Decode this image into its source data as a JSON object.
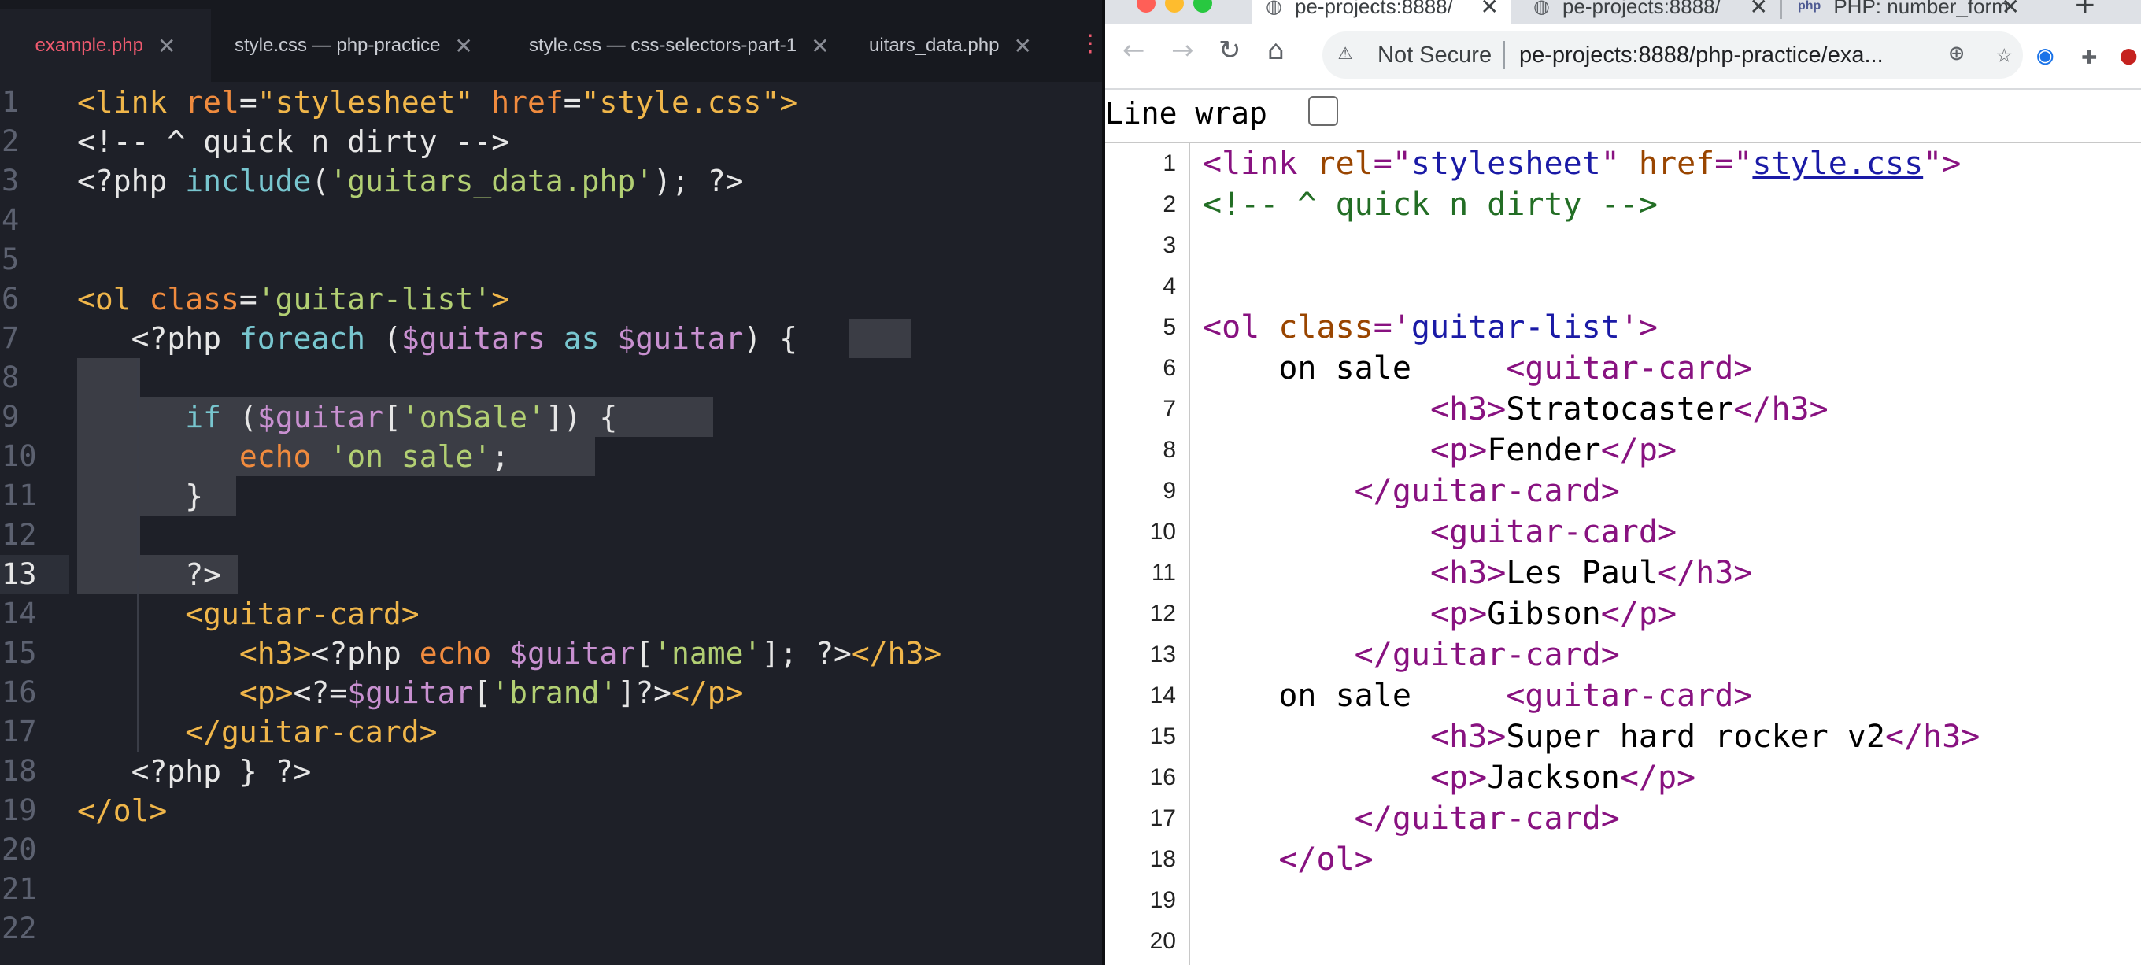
{
  "editor": {
    "tabs": [
      {
        "label": "example.php",
        "active": true
      },
      {
        "label": "style.css — php-practice",
        "active": false
      },
      {
        "label": "style.css — css-selectors-part-1",
        "active": false
      },
      {
        "label": "uitars_data.php",
        "active": false
      }
    ],
    "current_line": 13,
    "lines": [
      {
        "n": "1",
        "tokens": [
          {
            "t": "<link ",
            "c": "y"
          },
          {
            "t": "rel",
            "c": "o"
          },
          {
            "t": "=",
            "c": "t"
          },
          {
            "t": "\"stylesheet\"",
            "c": "y"
          },
          {
            "t": " ",
            "c": "t"
          },
          {
            "t": "href",
            "c": "o"
          },
          {
            "t": "=",
            "c": "t"
          },
          {
            "t": "\"style.css\"",
            "c": "y"
          },
          {
            "t": ">",
            "c": "y"
          }
        ]
      },
      {
        "n": "2",
        "tokens": [
          {
            "t": "<!-- ^ quick n dirty -->",
            "c": "t"
          }
        ]
      },
      {
        "n": "3",
        "tokens": [
          {
            "t": "<?php ",
            "c": "t"
          },
          {
            "t": "include",
            "c": "c"
          },
          {
            "t": "(",
            "c": "t"
          },
          {
            "t": "'guitars_data.php'",
            "c": "g"
          },
          {
            "t": "); ?>",
            "c": "t"
          }
        ]
      },
      {
        "n": "4",
        "tokens": []
      },
      {
        "n": "5",
        "tokens": []
      },
      {
        "n": "6",
        "tokens": [
          {
            "t": "<ol ",
            "c": "y"
          },
          {
            "t": "class",
            "c": "o"
          },
          {
            "t": "=",
            "c": "t"
          },
          {
            "t": "'guitar-list'",
            "c": "g"
          },
          {
            "t": ">",
            "c": "y"
          }
        ]
      },
      {
        "n": "7",
        "tokens": [
          {
            "t": "   <?php ",
            "c": "t"
          },
          {
            "t": "foreach",
            "c": "c"
          },
          {
            "t": " (",
            "c": "t"
          },
          {
            "t": "$guitars",
            "c": "p"
          },
          {
            "t": " as ",
            "c": "c"
          },
          {
            "t": "$guitar",
            "c": "p"
          },
          {
            "t": ") {",
            "c": "t"
          }
        ]
      },
      {
        "n": "8",
        "tokens": []
      },
      {
        "n": "9",
        "tokens": [
          {
            "t": "      ",
            "c": "t"
          },
          {
            "t": "if",
            "c": "c"
          },
          {
            "t": " (",
            "c": "t"
          },
          {
            "t": "$guitar",
            "c": "p"
          },
          {
            "t": "[",
            "c": "t"
          },
          {
            "t": "'onSale'",
            "c": "g"
          },
          {
            "t": "]) {",
            "c": "t"
          }
        ]
      },
      {
        "n": "10",
        "tokens": [
          {
            "t": "         ",
            "c": "t"
          },
          {
            "t": "echo",
            "c": "o"
          },
          {
            "t": " ",
            "c": "t"
          },
          {
            "t": "'on sale'",
            "c": "g"
          },
          {
            "t": ";",
            "c": "t"
          }
        ]
      },
      {
        "n": "11",
        "tokens": [
          {
            "t": "      }",
            "c": "t"
          }
        ]
      },
      {
        "n": "12",
        "tokens": []
      },
      {
        "n": "13",
        "tokens": [
          {
            "t": "      ?>",
            "c": "t"
          }
        ]
      },
      {
        "n": "14",
        "tokens": [
          {
            "t": "      <guitar-card>",
            "c": "y"
          }
        ]
      },
      {
        "n": "15",
        "tokens": [
          {
            "t": "         <h3>",
            "c": "y"
          },
          {
            "t": "<?php ",
            "c": "t"
          },
          {
            "t": "echo",
            "c": "o"
          },
          {
            "t": " ",
            "c": "t"
          },
          {
            "t": "$guitar",
            "c": "p"
          },
          {
            "t": "[",
            "c": "t"
          },
          {
            "t": "'name'",
            "c": "g"
          },
          {
            "t": "]; ?>",
            "c": "t"
          },
          {
            "t": "</h3>",
            "c": "y"
          }
        ]
      },
      {
        "n": "16",
        "tokens": [
          {
            "t": "         <p>",
            "c": "y"
          },
          {
            "t": "<?=",
            "c": "t"
          },
          {
            "t": "$guitar",
            "c": "p"
          },
          {
            "t": "[",
            "c": "t"
          },
          {
            "t": "'brand'",
            "c": "g"
          },
          {
            "t": "]?>",
            "c": "t"
          },
          {
            "t": "</p>",
            "c": "y"
          }
        ]
      },
      {
        "n": "17",
        "tokens": [
          {
            "t": "      </guitar-card>",
            "c": "y"
          }
        ]
      },
      {
        "n": "18",
        "tokens": [
          {
            "t": "   <?php } ?>",
            "c": "t"
          }
        ]
      },
      {
        "n": "19",
        "tokens": [
          {
            "t": "</ol>",
            "c": "y"
          }
        ]
      },
      {
        "n": "20",
        "tokens": []
      },
      {
        "n": "21",
        "tokens": []
      },
      {
        "n": "22",
        "tokens": []
      }
    ]
  },
  "browser": {
    "tabs": [
      {
        "label": "pe-projects:8888/",
        "active": true,
        "icon": "globe-icon"
      },
      {
        "label": "pe-projects:8888/",
        "active": false,
        "icon": "globe-icon"
      },
      {
        "label": "PHP: number_form",
        "active": false,
        "icon": "php-favicon"
      }
    ],
    "security_label": "Not Secure",
    "url": "pe-projects:8888/php-practice/exa...",
    "line_wrap_label": "Line wrap",
    "line_wrap_checked": false,
    "lines": [
      {
        "n": "1",
        "tokens": [
          {
            "t": "<link ",
            "c": "tg"
          },
          {
            "t": "rel",
            "c": "an"
          },
          {
            "t": "=\"",
            "c": "tg"
          },
          {
            "t": "stylesheet",
            "c": "av"
          },
          {
            "t": "\" ",
            "c": "tg"
          },
          {
            "t": "href",
            "c": "an"
          },
          {
            "t": "=\"",
            "c": "tg"
          },
          {
            "t": "style.css",
            "c": "lk"
          },
          {
            "t": "\">",
            "c": "tg"
          }
        ]
      },
      {
        "n": "2",
        "tokens": [
          {
            "t": "<!-- ^ quick n dirty -->",
            "c": "cm"
          }
        ]
      },
      {
        "n": "3",
        "tokens": []
      },
      {
        "n": "4",
        "tokens": []
      },
      {
        "n": "5",
        "tokens": [
          {
            "t": "<ol ",
            "c": "tg"
          },
          {
            "t": "class",
            "c": "an"
          },
          {
            "t": "='",
            "c": "tg"
          },
          {
            "t": "guitar-list",
            "c": "av"
          },
          {
            "t": "'>",
            "c": "tg"
          }
        ]
      },
      {
        "n": "6",
        "tokens": [
          {
            "t": "    on sale     ",
            "c": "tx"
          },
          {
            "t": "<guitar-card>",
            "c": "tg"
          }
        ]
      },
      {
        "n": "7",
        "tokens": [
          {
            "t": "            ",
            "c": "tx"
          },
          {
            "t": "<h3>",
            "c": "tg"
          },
          {
            "t": "Stratocaster",
            "c": "tx"
          },
          {
            "t": "</h3>",
            "c": "tg"
          }
        ]
      },
      {
        "n": "8",
        "tokens": [
          {
            "t": "            ",
            "c": "tx"
          },
          {
            "t": "<p>",
            "c": "tg"
          },
          {
            "t": "Fender",
            "c": "tx"
          },
          {
            "t": "</p>",
            "c": "tg"
          }
        ]
      },
      {
        "n": "9",
        "tokens": [
          {
            "t": "        ",
            "c": "tx"
          },
          {
            "t": "</guitar-card>",
            "c": "tg"
          }
        ]
      },
      {
        "n": "10",
        "tokens": [
          {
            "t": "            ",
            "c": "tx"
          },
          {
            "t": "<guitar-card>",
            "c": "tg"
          }
        ]
      },
      {
        "n": "11",
        "tokens": [
          {
            "t": "            ",
            "c": "tx"
          },
          {
            "t": "<h3>",
            "c": "tg"
          },
          {
            "t": "Les Paul",
            "c": "tx"
          },
          {
            "t": "</h3>",
            "c": "tg"
          }
        ]
      },
      {
        "n": "12",
        "tokens": [
          {
            "t": "            ",
            "c": "tx"
          },
          {
            "t": "<p>",
            "c": "tg"
          },
          {
            "t": "Gibson",
            "c": "tx"
          },
          {
            "t": "</p>",
            "c": "tg"
          }
        ]
      },
      {
        "n": "13",
        "tokens": [
          {
            "t": "        ",
            "c": "tx"
          },
          {
            "t": "</guitar-card>",
            "c": "tg"
          }
        ]
      },
      {
        "n": "14",
        "tokens": [
          {
            "t": "    on sale     ",
            "c": "tx"
          },
          {
            "t": "<guitar-card>",
            "c": "tg"
          }
        ]
      },
      {
        "n": "15",
        "tokens": [
          {
            "t": "            ",
            "c": "tx"
          },
          {
            "t": "<h3>",
            "c": "tg"
          },
          {
            "t": "Super hard rocker v2",
            "c": "tx"
          },
          {
            "t": "</h3>",
            "c": "tg"
          }
        ]
      },
      {
        "n": "16",
        "tokens": [
          {
            "t": "            ",
            "c": "tx"
          },
          {
            "t": "<p>",
            "c": "tg"
          },
          {
            "t": "Jackson",
            "c": "tx"
          },
          {
            "t": "</p>",
            "c": "tg"
          }
        ]
      },
      {
        "n": "17",
        "tokens": [
          {
            "t": "        ",
            "c": "tx"
          },
          {
            "t": "</guitar-card>",
            "c": "tg"
          }
        ]
      },
      {
        "n": "18",
        "tokens": [
          {
            "t": "    ",
            "c": "tx"
          },
          {
            "t": "</ol>",
            "c": "tg"
          }
        ]
      },
      {
        "n": "19",
        "tokens": []
      },
      {
        "n": "20",
        "tokens": []
      }
    ]
  },
  "colors": {
    "editor_bg": "#1e2028",
    "active_tab_text": "#ef5a6f",
    "html_tag": "#f0b64a",
    "php_string": "#b2cf73",
    "php_keyword": "#78c6cf",
    "php_variable": "#c890d0",
    "source_tag": "#881280",
    "source_attr_name": "#994500",
    "source_attr_value": "#1a1aa6",
    "source_comment": "#236e25"
  }
}
